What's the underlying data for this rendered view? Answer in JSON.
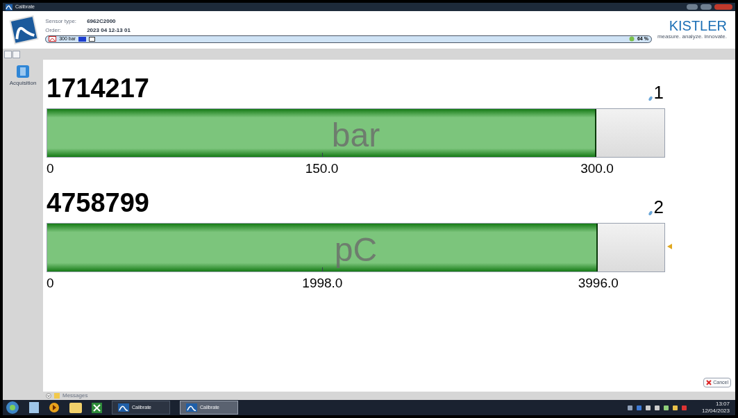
{
  "window": {
    "title": "Calibrate"
  },
  "header": {
    "sensor_type_label": "Sensor type:",
    "sensor_type": "6962C2000",
    "order_label": "Order:",
    "order": "2023 04 12-13 01",
    "range": "300 bar",
    "progress": "64 %",
    "brand": "KISTLER",
    "tagline": "measure. analyze. innovate."
  },
  "sidebar": {
    "items": [
      {
        "label": "Acquisition"
      }
    ]
  },
  "channels": [
    {
      "value": "1714217",
      "number": "1",
      "unit": "bar",
      "level": 0.89,
      "ticks": [
        "0",
        "150.0",
        "300.0"
      ],
      "marker": false
    },
    {
      "value": "4758799",
      "number": "2",
      "unit": "pC",
      "level": 0.892,
      "ticks": [
        "0",
        "1998.0",
        "3996.0"
      ],
      "marker": true
    }
  ],
  "buttons": [
    {
      "label": "Cancel"
    }
  ],
  "messages": {
    "label": "Messages"
  },
  "taskbar": {
    "items": [
      {
        "label": "Calibrate",
        "selected": false
      },
      {
        "label": "Calibrate",
        "selected": true
      }
    ],
    "time": "13:07",
    "date": "12/04/2023"
  }
}
